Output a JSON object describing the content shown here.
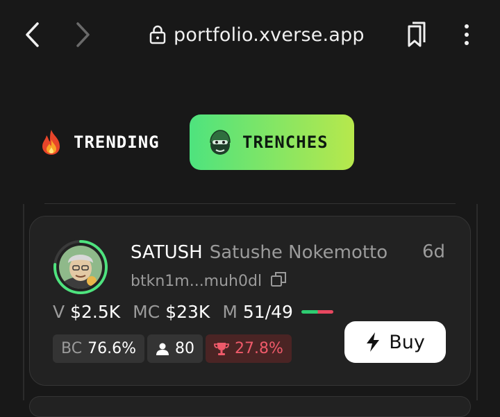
{
  "browser": {
    "url": "portfolio.xverse.app"
  },
  "tabs": [
    {
      "label": "TRENDING",
      "icon": "fire-icon",
      "active": false
    },
    {
      "label": "TRENCHES",
      "icon": "helmet-icon",
      "active": true
    }
  ],
  "token": {
    "ticker": "SATUSH",
    "name": "Satushe Nokemotto",
    "age": "6d",
    "address": "btkn1m...muh0dl",
    "stats": [
      {
        "label": "V",
        "value": "$2.5K"
      },
      {
        "label": "MC",
        "value": "$23K"
      },
      {
        "label": "M",
        "value": "51/49"
      }
    ],
    "buy_ratio_percent": 51,
    "badges": {
      "bc_label": "BC",
      "bc_value": "76.6%",
      "holders": "80",
      "top_holders": "27.8%"
    },
    "buy_label": "Buy"
  },
  "colors": {
    "background": "#181818",
    "card": "#222222",
    "accent_green": "#4ee37e",
    "accent_lime": "#b7e84c",
    "danger": "#ef5a6a"
  }
}
